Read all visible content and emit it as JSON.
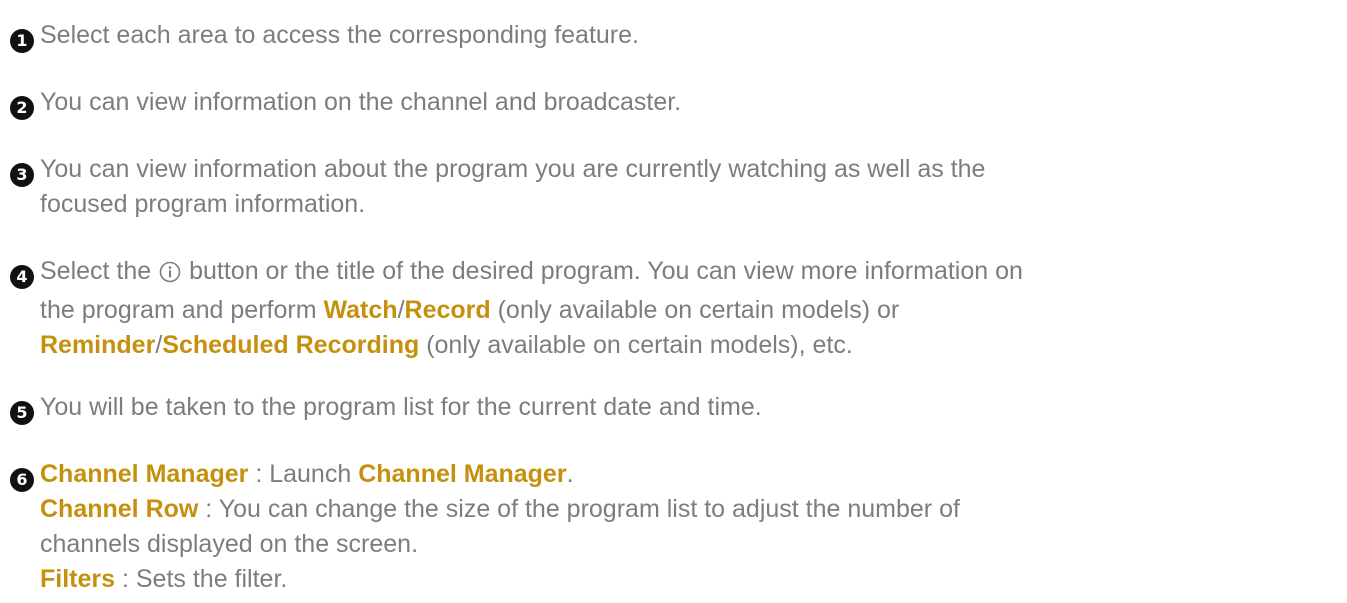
{
  "steps": [
    {
      "number": "1",
      "text": "Select each area to access the corresponding feature."
    },
    {
      "number": "2",
      "text": "You can view information on the channel and broadcaster."
    },
    {
      "number": "3",
      "line1": "You can view information about the program you are currently watching as well as the",
      "line2": "focused program information."
    },
    {
      "number": "4",
      "line1_pre": "Select the",
      "info_icon": "info-icon",
      "line1_post": "button or the title of the desired program. You can view more information on",
      "line2_pre": "the program and perform",
      "watch": "Watch",
      "slash1": "/",
      "record": "Record",
      "line2_post": "(only available on certain models) or",
      "reminder": "Reminder",
      "slash2": "/",
      "scheduled_recording": "Scheduled Recording",
      "line3_post": "(only available on certain models), etc."
    },
    {
      "number": "5",
      "text": "You will be taken to the program list for the current date and time."
    },
    {
      "number": "6",
      "channel_manager_label": "Channel Manager",
      "channel_manager_sep": " : Launch ",
      "channel_manager_target": "Channel Manager",
      "channel_manager_end": ".",
      "channel_row_label": "Channel Row",
      "channel_row_line1": " : You can change the size of the program list to adjust the number of",
      "channel_row_line2": "channels displayed on the screen.",
      "filters_label": "Filters",
      "filters_text": " : Sets the filter."
    }
  ],
  "colors": {
    "text": "#7d7d7d",
    "highlight": "#c6900f",
    "badge": "#111111"
  }
}
